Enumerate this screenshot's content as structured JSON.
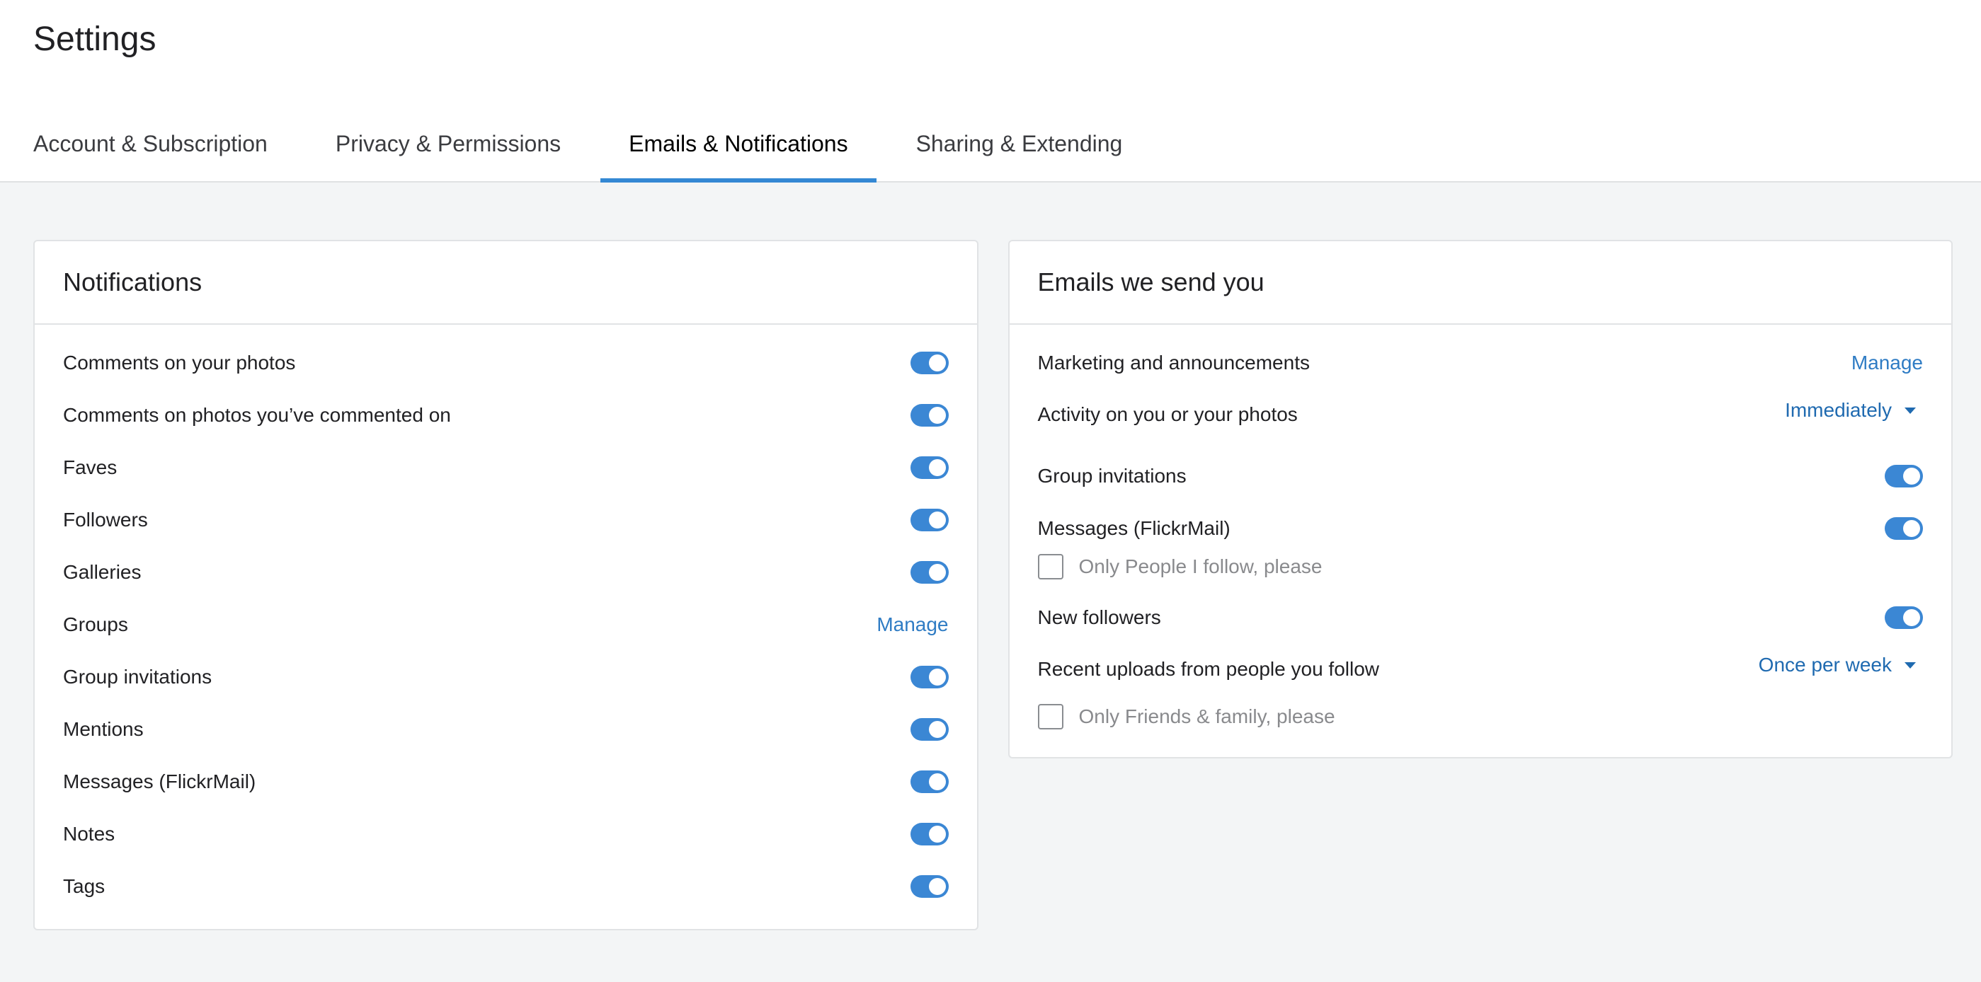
{
  "page": {
    "title": "Settings"
  },
  "tabs": [
    {
      "label": "Account & Subscription",
      "active": false
    },
    {
      "label": "Privacy & Permissions",
      "active": false
    },
    {
      "label": "Emails & Notifications",
      "active": true
    },
    {
      "label": "Sharing & Extending",
      "active": false
    }
  ],
  "notifications": {
    "title": "Notifications",
    "rows": [
      {
        "label": "Comments on your photos",
        "control": "toggle",
        "on": true
      },
      {
        "label": "Comments on photos you’ve commented on",
        "control": "toggle",
        "on": true
      },
      {
        "label": "Faves",
        "control": "toggle",
        "on": true
      },
      {
        "label": "Followers",
        "control": "toggle",
        "on": true
      },
      {
        "label": "Galleries",
        "control": "toggle",
        "on": true
      },
      {
        "label": "Groups",
        "control": "link",
        "link_label": "Manage"
      },
      {
        "label": "Group invitations",
        "control": "toggle",
        "on": true
      },
      {
        "label": "Mentions",
        "control": "toggle",
        "on": true
      },
      {
        "label": "Messages (FlickrMail)",
        "control": "toggle",
        "on": true
      },
      {
        "label": "Notes",
        "control": "toggle",
        "on": true
      },
      {
        "label": "Tags",
        "control": "toggle",
        "on": true
      }
    ]
  },
  "emails": {
    "title": "Emails we send you",
    "marketing": {
      "label": "Marketing and announcements",
      "link_label": "Manage"
    },
    "activity": {
      "label": "Activity on you or your photos",
      "selected": "Immediately"
    },
    "group_invitations": {
      "label": "Group invitations",
      "on": true
    },
    "messages": {
      "label": "Messages (FlickrMail)",
      "on": true,
      "checkbox_label": "Only People I follow, please",
      "checked": false
    },
    "new_followers": {
      "label": "New followers",
      "on": true
    },
    "recent_uploads": {
      "label": "Recent uploads from people you follow",
      "selected": "Once per week",
      "checkbox_label": "Only Friends & family, please",
      "checked": false
    }
  },
  "colors": {
    "accent": "#3b87d4",
    "link": "#2f7cc4",
    "background": "#f3f5f6"
  }
}
